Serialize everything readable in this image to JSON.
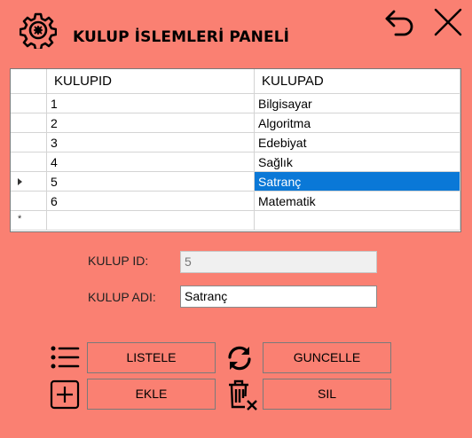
{
  "header": {
    "title": "KULUP İSLEMLERİ PANELİ"
  },
  "grid": {
    "columns": [
      "KULUPID",
      "KULUPAD"
    ],
    "rows": [
      {
        "id": "1",
        "name": "Bilgisayar"
      },
      {
        "id": "2",
        "name": "Algoritma"
      },
      {
        "id": "3",
        "name": "Edebiyat"
      },
      {
        "id": "4",
        "name": "Sağlık"
      },
      {
        "id": "5",
        "name": "Satranç"
      },
      {
        "id": "6",
        "name": "Matematik"
      }
    ],
    "selected_row_index": 4,
    "new_row_marker": "*"
  },
  "form": {
    "id_label": "KULUP ID:",
    "id_value": "5",
    "name_label": "KULUP ADI:",
    "name_value": "Satranç"
  },
  "buttons": {
    "list": "LISTELE",
    "update": "GUNCELLE",
    "add": "EKLE",
    "delete": "SIL"
  },
  "icons": {
    "app": "gear-brain-icon",
    "back": "undo-icon",
    "close": "close-icon",
    "list": "list-icon",
    "refresh": "refresh-icon",
    "add": "add-box-icon",
    "delete": "trash-x-icon"
  },
  "colors": {
    "background": "#fa8072",
    "selection": "#0a78d7"
  }
}
